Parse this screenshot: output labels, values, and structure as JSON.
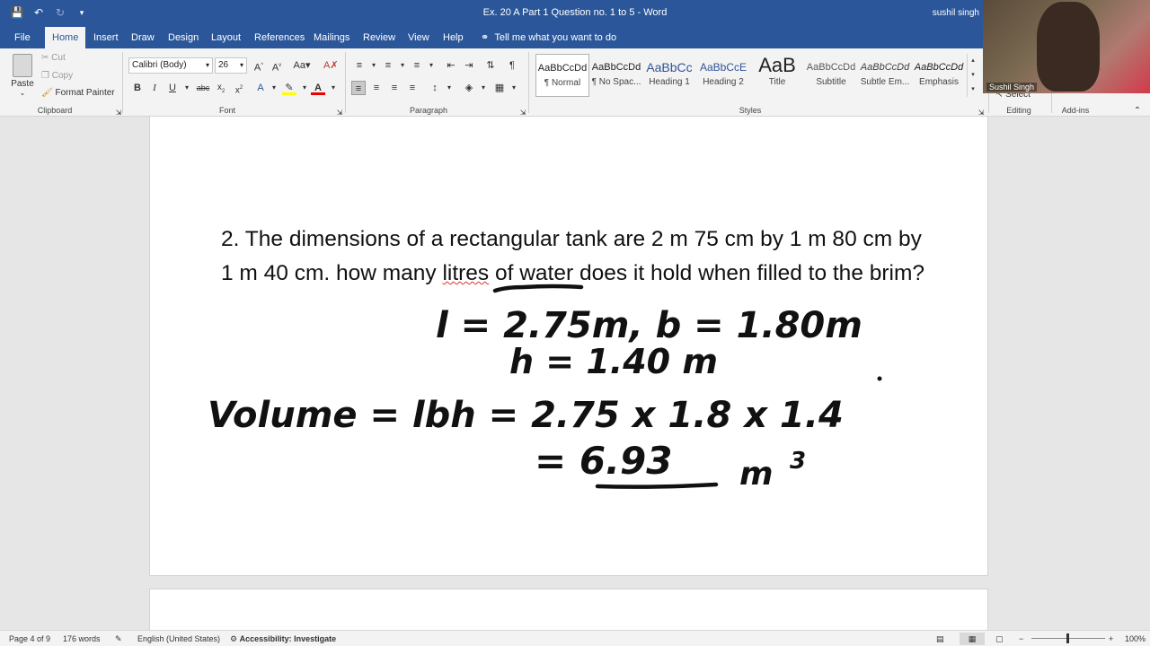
{
  "window": {
    "title": "Ex. 20 A Part 1 Question no. 1 to 5  -  Word",
    "user": "sushil singh"
  },
  "tabs": [
    "File",
    "Home",
    "Insert",
    "Draw",
    "Design",
    "Layout",
    "References",
    "Mailings",
    "Review",
    "View",
    "Help"
  ],
  "tellme": "Tell me what you want to do",
  "clipboard": {
    "paste": "Paste",
    "cut": "Cut",
    "copy": "Copy",
    "format_painter": "Format Painter",
    "label": "Clipboard"
  },
  "font": {
    "family": "Calibri (Body)",
    "size": "26",
    "label": "Font"
  },
  "paragraph": {
    "label": "Paragraph"
  },
  "styles": {
    "label": "Styles",
    "items": [
      {
        "sample": "AaBbCcDd",
        "name": "¶ Normal"
      },
      {
        "sample": "AaBbCcDd",
        "name": "¶ No Spac..."
      },
      {
        "sample": "AaBbCc",
        "name": "Heading 1"
      },
      {
        "sample": "AaBbCcE",
        "name": "Heading 2"
      },
      {
        "sample": "AaB",
        "name": "Title"
      },
      {
        "sample": "AaBbCcDd",
        "name": "Subtitle"
      },
      {
        "sample": "AaBbCcDd",
        "name": "Subtle Em..."
      },
      {
        "sample": "AaBbCcDd",
        "name": "Emphasis"
      }
    ]
  },
  "editing": {
    "label": "Editing",
    "select": "Select"
  },
  "addins": {
    "label": "Add-ins"
  },
  "video": {
    "name": "Sushil Singh"
  },
  "document": {
    "question_part1": "2. The dimensions of a rectangular tank are 2 m 75 cm by 1 m 80 cm by 1 m 40 cm. how many ",
    "question_word": "litres",
    "question_part2": " of water does it hold when filled to the brim?",
    "hw_line1": "l = 2.75m, b = 1.80m",
    "hw_line2": "h = 1.40 m",
    "hw_line3": "Volume = lbh = 2.75 x 1.8 x 1.4",
    "hw_line4": "= 6.93",
    "hw_unit": "m",
    "hw_exp": "3"
  },
  "status": {
    "page": "Page 4 of 9",
    "words": "176 words",
    "language": "English (United States)",
    "accessibility": "Accessibility: Investigate",
    "zoom": "100%"
  },
  "colors": {
    "titlebar": "#2b579a",
    "ribbon": "#f3f3f3",
    "canvas": "#e6e6e6"
  }
}
